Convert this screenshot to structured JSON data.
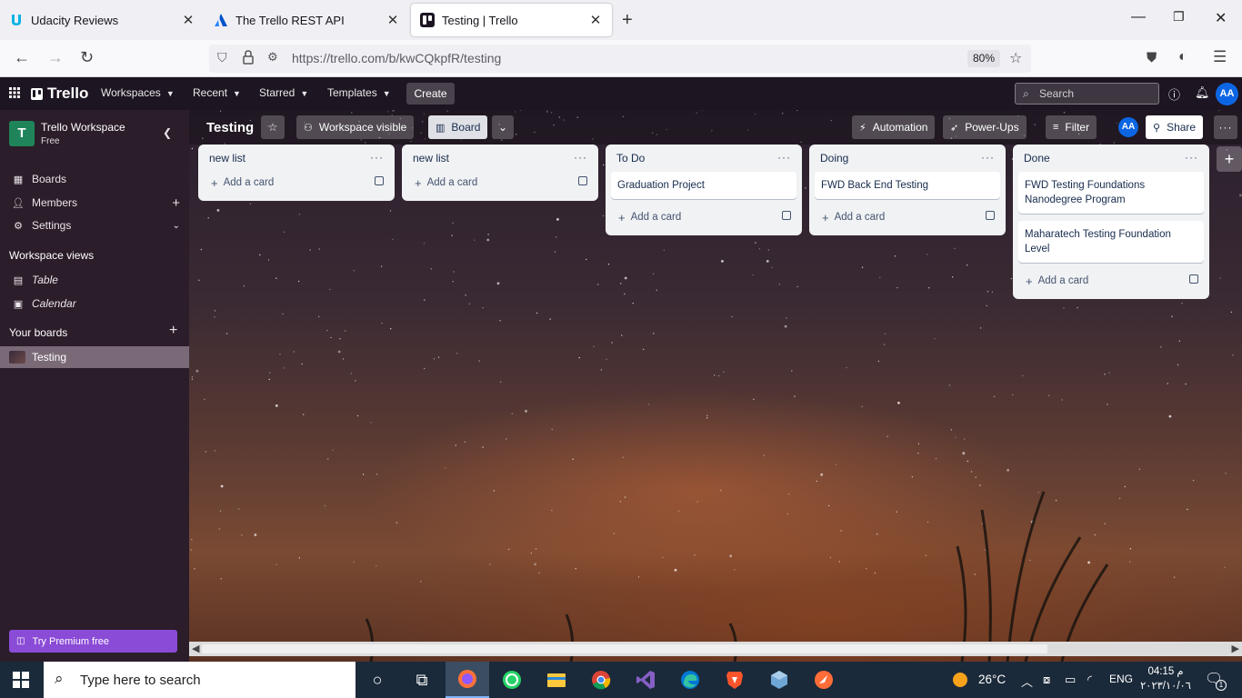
{
  "browser": {
    "tabs": [
      {
        "title": "Udacity Reviews",
        "icon": "udacity-icon"
      },
      {
        "title": "The Trello REST API",
        "icon": "atlassian-icon"
      },
      {
        "title": "Testing | Trello",
        "icon": "trello-icon",
        "active": true
      }
    ],
    "url": "https://trello.com/b/kwCQkpfR/testing",
    "zoom": "80%"
  },
  "header": {
    "logo": "Trello",
    "menus": [
      "Workspaces",
      "Recent",
      "Starred",
      "Templates"
    ],
    "create_label": "Create",
    "search_placeholder": "Search",
    "avatar_initials": "AA"
  },
  "sidebar": {
    "workspace_initial": "T",
    "workspace_name": "Trello Workspace",
    "workspace_plan": "Free",
    "items": [
      {
        "label": "Boards",
        "icon": "board-icon"
      },
      {
        "label": "Members",
        "icon": "person-icon"
      },
      {
        "label": "Settings",
        "icon": "gear-icon"
      }
    ],
    "views_heading": "Workspace views",
    "views": [
      {
        "label": "Table",
        "icon": "table-icon"
      },
      {
        "label": "Calendar",
        "icon": "calendar-icon"
      }
    ],
    "boards_heading": "Your boards",
    "boards": [
      {
        "label": "Testing"
      }
    ],
    "premium_label": "Try Premium free"
  },
  "board": {
    "title": "Testing",
    "visibility_label": "Workspace visible",
    "view_label": "Board",
    "automation_label": "Automation",
    "powerups_label": "Power-Ups",
    "filter_label": "Filter",
    "share_label": "Share",
    "member_initials": "AA",
    "add_card_label": "Add a card",
    "lists": [
      {
        "title": "new list",
        "cards": []
      },
      {
        "title": "new list",
        "cards": []
      },
      {
        "title": "To Do",
        "cards": [
          "Graduation Project"
        ]
      },
      {
        "title": "Doing",
        "cards": [
          "FWD Back End Testing"
        ]
      },
      {
        "title": "Done",
        "cards": [
          "FWD Testing Foundations Nanodegree Program",
          "Maharatech Testing Foundation Level"
        ]
      }
    ]
  },
  "taskbar": {
    "search_placeholder": "Type here to search",
    "weather": "26°C",
    "language": "ENG",
    "time": "04:15 م",
    "date": "٢٠٢٣/١٠/٠٦",
    "notification_count": "1"
  }
}
